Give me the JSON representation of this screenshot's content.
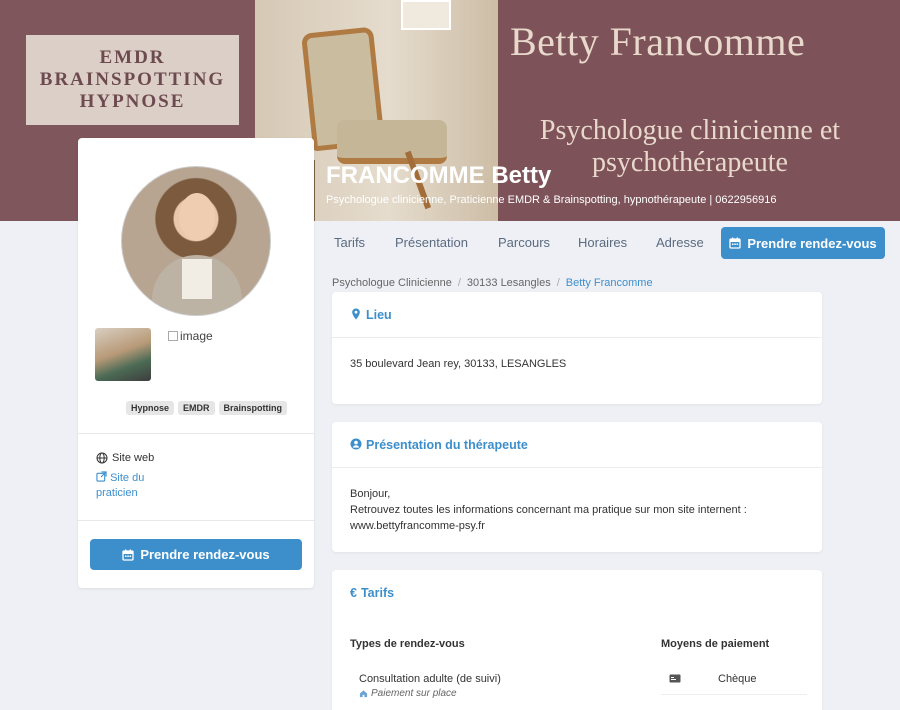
{
  "banner": {
    "logo_lines": [
      "EMDR",
      "BRAINSPOTTING",
      "HYPNOSE"
    ],
    "title": "Betty Francomme",
    "subtitle_line1": "Psychologue clinicienne et",
    "subtitle_line2": "psychothérapeute",
    "name": "FRANCOMME Betty",
    "description": "Psychologue clinicienne, Praticienne EMDR & Brainspotting, hypnothérapeute | 0622956916"
  },
  "nav": {
    "items": [
      "Tarifs",
      "Présentation",
      "Parcours",
      "Horaires",
      "Adresse"
    ],
    "cta": "Prendre rendez-vous"
  },
  "breadcrumb": {
    "items": [
      "Psychologue Clinicienne",
      "30133 Lesangles"
    ],
    "current": "Betty Francomme"
  },
  "sidebar": {
    "broken_image_alt": "image",
    "tags": [
      "Hypnose",
      "EMDR",
      "Brainspotting"
    ],
    "site_label": "Site web",
    "site_link": "Site du praticien",
    "cta": "Prendre rendez-vous"
  },
  "lieu": {
    "title": "Lieu",
    "address": "35 boulevard Jean rey, 30133, LESANGLES"
  },
  "presentation": {
    "title": "Présentation du thérapeute",
    "line1": "Bonjour,",
    "line2": "Retrouvez toutes les informations concernant ma pratique sur mon site internent :",
    "line3": "www.bettyfrancomme-psy.fr"
  },
  "tarifs": {
    "title": "Tarifs",
    "col_types": "Types de rendez-vous",
    "col_payment": "Moyens de paiement",
    "rows": [
      {
        "type": "Consultation adulte (de suivi)",
        "note": "Paiement sur place"
      }
    ],
    "payments": [
      "Chèque"
    ]
  },
  "colors": {
    "accent": "#3d8fcc",
    "banner": "#7d5359",
    "background": "#eef0f5"
  }
}
